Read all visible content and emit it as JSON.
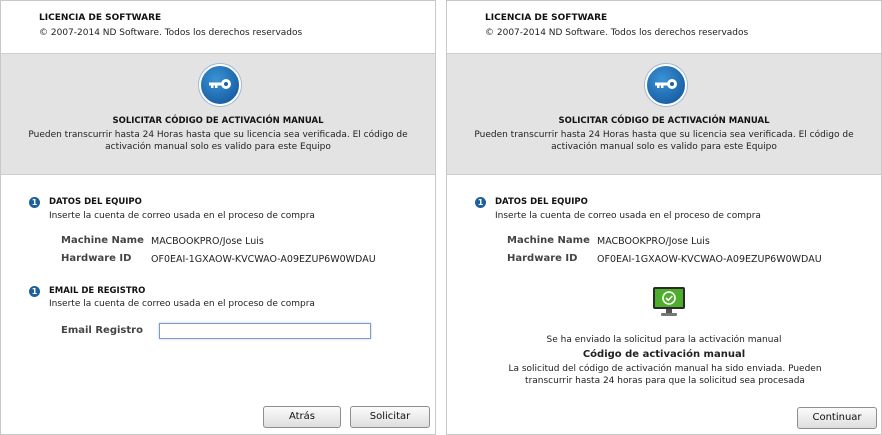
{
  "left": {
    "header": {
      "title": "LICENCIA DE SOFTWARE",
      "copyright": "© 2007-2014 ND Software. Todos los derechos reservados"
    },
    "band": {
      "title": "SOLICITAR CÓDIGO DE ACTIVACIÓN MANUAL",
      "text": "Pueden transcurrir hasta 24 Horas hasta que su licencia sea verificada. El código de activación manual solo es valido para este Equipo"
    },
    "device": {
      "title": "DATOS DEL EQUIPO",
      "desc": "Inserte la cuenta de correo usada en el proceso de compra",
      "machine_label": "Machine Name",
      "machine_value": "MACBOOKPRO/Jose Luis",
      "hardware_label": "Hardware ID",
      "hardware_value": "OF0EAI-1GXAOW-KVCWAO-A09EZUP6W0WDAU"
    },
    "email": {
      "title": "EMAIL DE REGISTRO",
      "desc": "Inserte la cuenta de correo usada en el proceso de compra",
      "label": "Email Registro",
      "value": ""
    },
    "buttons": {
      "back": "Atrás",
      "request": "Solicitar"
    }
  },
  "right": {
    "header": {
      "title": "LICENCIA DE SOFTWARE",
      "copyright": "© 2007-2014 ND Software. Todos los derechos reservados"
    },
    "band": {
      "title": "SOLICITAR CÓDIGO DE ACTIVACIÓN MANUAL",
      "text": "Pueden transcurrir hasta 24 Horas hasta que su licencia sea verificada. El código de activación manual solo es valido para este Equipo"
    },
    "device": {
      "title": "DATOS DEL EQUIPO",
      "desc": "Inserte la cuenta de correo usada en el proceso de compra",
      "machine_label": "Machine Name",
      "machine_value": "MACBOOKPRO/Jose Luis",
      "hardware_label": "Hardware ID",
      "hardware_value": "OF0EAI-1GXAOW-KVCWAO-A09EZUP6W0WDAU"
    },
    "result": {
      "sent": "Se ha enviado la solicitud para la activación manual",
      "title": "Código de activación manual",
      "desc": "La solicitud del código de activación manual ha sido enviada. Pueden transcurrir hasta 24 horas para que la solicitud sea procesada"
    },
    "buttons": {
      "continue": "Continuar"
    }
  },
  "icons": {
    "section": "info-icon",
    "band": "key-icon",
    "result": "monitor-check-icon"
  },
  "colors": {
    "band_bg": "#e3e3e3",
    "key_blue": "#1b63a8",
    "section_icon": "#1f5f9e",
    "monitor_green": "#4cae2a"
  }
}
